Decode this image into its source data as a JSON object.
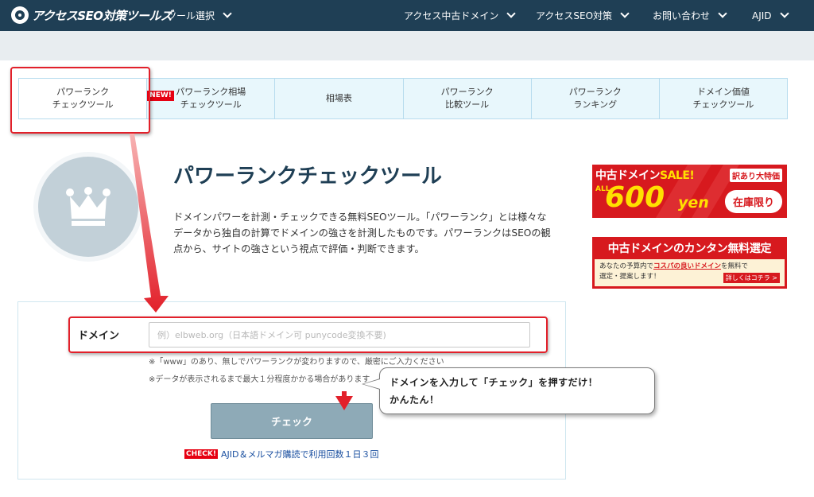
{
  "header": {
    "logo_text": "アクセスSEO対策ツールズ",
    "nav": [
      {
        "label": "ツール選択"
      },
      {
        "label": "アクセス中古ドメイン"
      },
      {
        "label": "アクセスSEO対策"
      },
      {
        "label": "お問い合わせ"
      },
      {
        "label": "AJID"
      }
    ]
  },
  "tabs": [
    {
      "label": "パワーランク\nチェックツール",
      "active": true
    },
    {
      "label": "パワーランク相場\nチェックツール",
      "badge": "NEW!"
    },
    {
      "label": "相場表"
    },
    {
      "label": "パワーランク\n比較ツール"
    },
    {
      "label": "パワーランク\nランキング"
    },
    {
      "label": "ドメイン価値\nチェックツール"
    }
  ],
  "main": {
    "icon": "crown-icon",
    "title": "パワーランクチェックツール",
    "intro": "ドメインパワーを計測・チェックできる無料SEOツール。「パワーランク」とは様々なデータから独自の計算でドメインの強さを計測したものです。パワーランクはSEOの観点から、サイトの強さという視点で評価・判断できます。"
  },
  "form": {
    "domain_label": "ドメイン",
    "domain_placeholder": "例）elbweb.org（日本語ドメイン可 punycode変換不要)",
    "domain_value": "",
    "note1": "※「www」のあり、無しでパワーランクが変わりますので、厳密にご入力ください",
    "note2": "※データが表示されるまで最大１分程度かかる場合があります",
    "check_button": "チェック",
    "promo_badge": "CHECK!",
    "promo_link": "AJID＆メルマガ購読で利用回数１日３回"
  },
  "callout": {
    "text": "ドメインを入力して「チェック」を押すだけ！\nかんたん！"
  },
  "banners": {
    "sale": {
      "heading": "中古ドメイン",
      "sale_word": "SALE!",
      "tag": "訳あり大特価",
      "all": "ALL",
      "price": "600",
      "unit": "yen",
      "limited": "在庫限り"
    },
    "select": {
      "heading": "中古ドメインのカンタン無料選定",
      "body_pre": "あなたの予算内で",
      "body_em": "コスパの良いドメイン",
      "body_post": "を無料で選定・提案します！",
      "link": "詳しくはコチラ >"
    }
  },
  "colors": {
    "header_bg": "#1f3f55",
    "accent_red": "#e2202a",
    "tab_bg": "#e8f7fc",
    "button_bg": "#8eaab7",
    "link": "#1a4fa0"
  }
}
